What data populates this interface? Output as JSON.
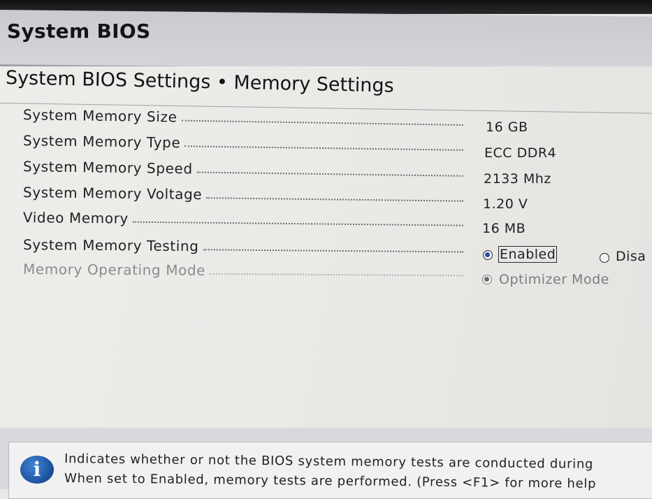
{
  "window": {
    "title": "System BIOS"
  },
  "breadcrumb": "System BIOS Settings • Memory Settings",
  "settings": [
    {
      "label": "System Memory Size",
      "value": "16 GB"
    },
    {
      "label": "System Memory Type",
      "value": "ECC DDR4"
    },
    {
      "label": "System Memory Speed",
      "value": "2133 Mhz"
    },
    {
      "label": "System Memory Voltage",
      "value": "1.20 V"
    },
    {
      "label": "Video Memory",
      "value": "16 MB"
    },
    {
      "label": "System Memory Testing",
      "options": [
        {
          "label": "Enabled",
          "selected": true,
          "focused": true
        },
        {
          "label": "Disa",
          "selected": false
        }
      ]
    },
    {
      "label": "Memory Operating Mode",
      "disabled": true,
      "options": [
        {
          "label": "Optimizer Mode",
          "selected": true
        }
      ]
    }
  ],
  "help": {
    "icon": "info-icon",
    "lines": [
      "Indicates whether or not the BIOS system memory tests are conducted during",
      "When set to Enabled, memory tests are performed. (Press <F1> for more help"
    ]
  },
  "colors": {
    "header_bg": "#c9cbcf",
    "content_bg": "#ebe9e6",
    "radio_selected": "#1f4fa8",
    "disabled_text": "#8a8a8f",
    "info_icon": "#1a4f9a"
  }
}
